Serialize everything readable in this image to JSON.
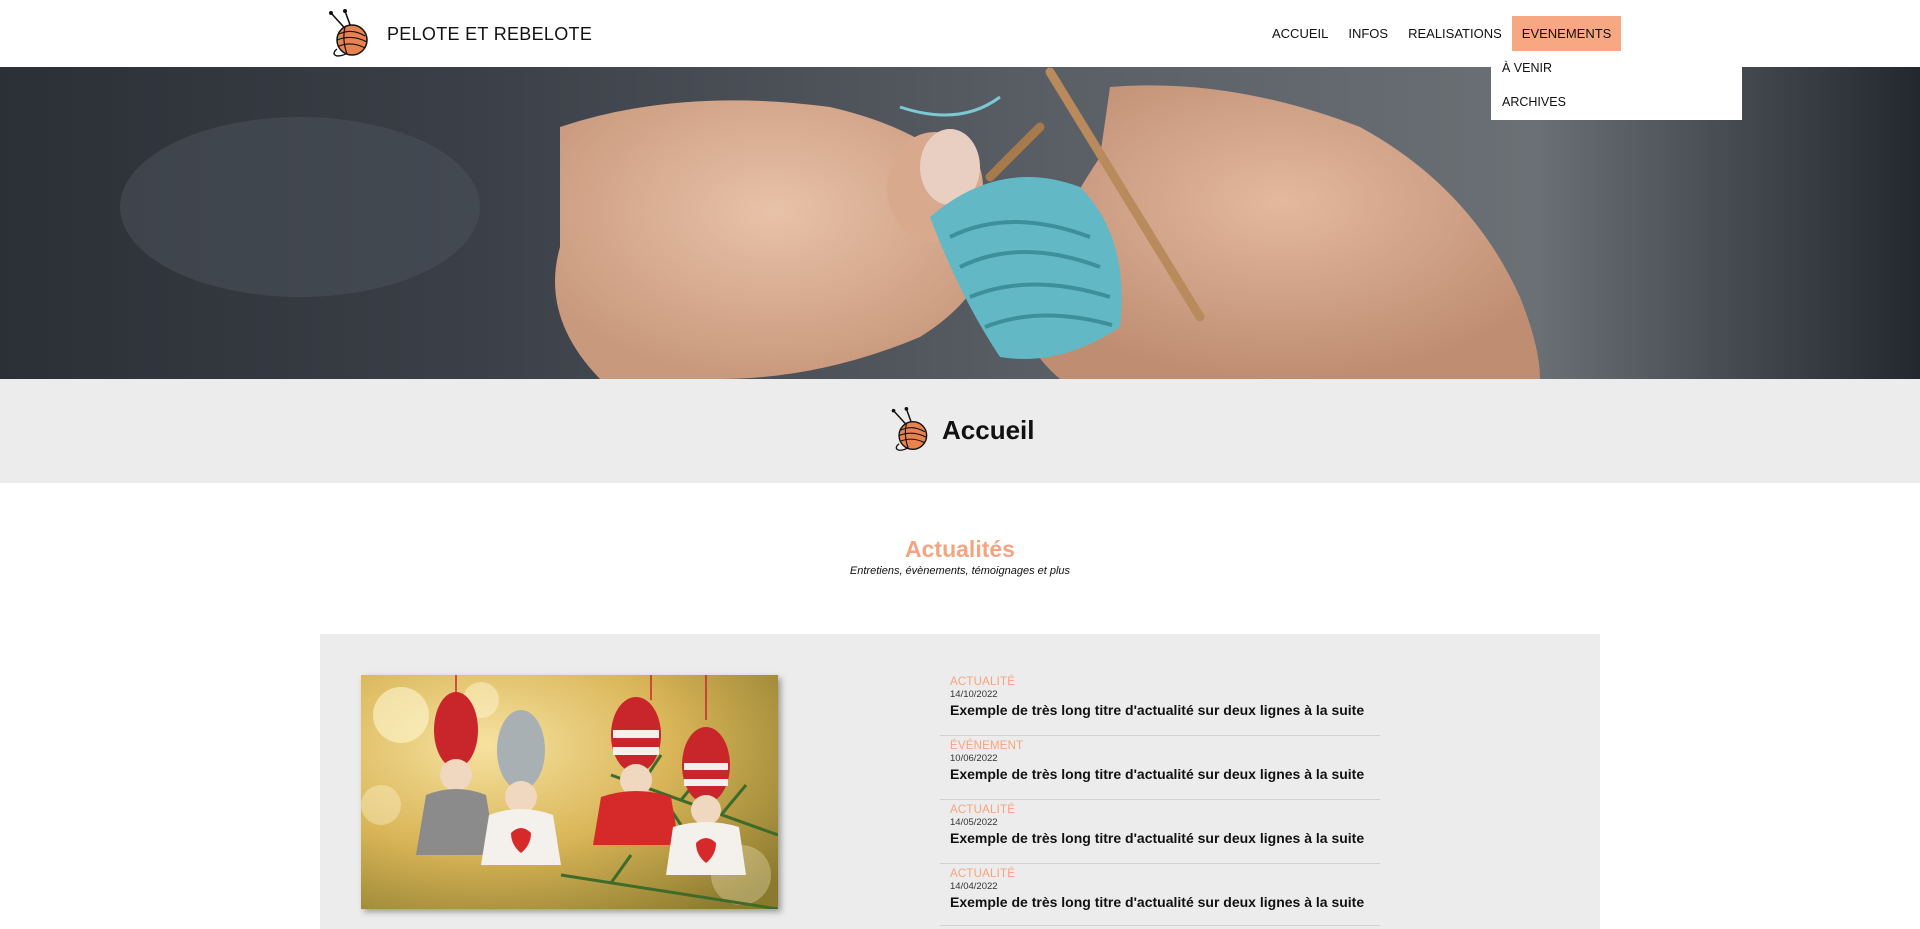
{
  "header": {
    "brand_name": "PELOTE ET REBELOTE",
    "logo_icon": "yarn-ball-with-needles-icon",
    "nav": [
      {
        "label": "ACCUEIL",
        "active": false
      },
      {
        "label": "INFOS",
        "active": false
      },
      {
        "label": "REALISATIONS",
        "active": false
      },
      {
        "label": "EVENEMENTS",
        "active": true
      }
    ],
    "dropdown": [
      "À VENIR",
      "ARCHIVES"
    ]
  },
  "page": {
    "title": "Accueil"
  },
  "news": {
    "title": "Actualités",
    "subtitle": "Entretiens, évènements, témoignages et plus",
    "items": [
      {
        "category": "ACTUALITÉ",
        "date": "14/10/2022",
        "title": "Exemple de très long titre d'actualité sur deux lignes à la suite"
      },
      {
        "category": "ÉVÉNEMENT",
        "date": "10/06/2022",
        "title": "Exemple de très long titre d'actualité sur deux lignes à la suite"
      },
      {
        "category": "ACTUALITÉ",
        "date": "14/05/2022",
        "title": "Exemple de très long titre d'actualité sur deux lignes à la suite"
      },
      {
        "category": "ACTUALITÉ",
        "date": "14/04/2022",
        "title": "Exemple de très long titre d'actualité sur deux lignes à la suite"
      }
    ]
  },
  "colors": {
    "accent": "#f7a882",
    "accent_text": "#f5a47f",
    "band_grey": "#ececec"
  }
}
